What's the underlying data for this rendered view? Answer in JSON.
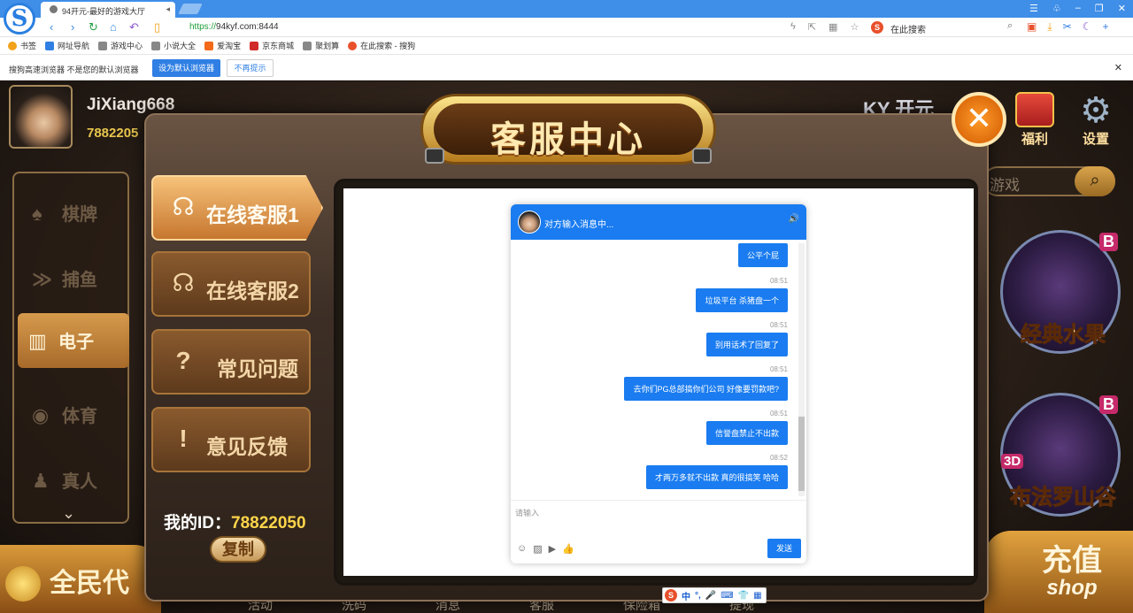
{
  "browser": {
    "logo": "S",
    "tab_title": "94开元-最好的游戏大厅",
    "tab_close": "◂",
    "url_scheme": "https://",
    "url_host": "94kyf.com:8444",
    "search_engine_label": "S",
    "search_placeholder": "在此搜索",
    "bookmarks": [
      {
        "label": "书签",
        "color": "#f2a21a"
      },
      {
        "label": "网址导航",
        "color": "#2f7fe4"
      },
      {
        "label": "游戏中心",
        "color": "#888888"
      },
      {
        "label": "小说大全",
        "color": "#888888"
      },
      {
        "label": "爱淘宝",
        "color": "#f26a1a"
      },
      {
        "label": "京东商城",
        "color": "#d12a2a"
      },
      {
        "label": "聚划算",
        "color": "#888888"
      },
      {
        "label": "在此搜索 - 搜狗",
        "color": "#e8502c"
      }
    ],
    "infobar": {
      "text": "搜狗高速浏览器 不是您的默认浏览器",
      "set_default": "设为默认浏览器",
      "dont_remind": "不再提示",
      "close": "✕"
    }
  },
  "game": {
    "username": "JiXiang668",
    "user_id_partial": "7882205",
    "side_menu": [
      {
        "label": "棋牌",
        "icon": "card-icon"
      },
      {
        "label": "捕鱼",
        "icon": "fish-icon"
      },
      {
        "label": "电子",
        "icon": "slot-icon",
        "active": true
      },
      {
        "label": "体育",
        "icon": "ball-icon"
      },
      {
        "label": "真人",
        "icon": "person-icon"
      }
    ],
    "quanmin": "全民代",
    "top_right_logo": "KY 开元",
    "fuli": "福利",
    "shezhi": "设置",
    "search_game": "游戏",
    "tiles": [
      {
        "name": "经典水果",
        "badge": "B"
      },
      {
        "name": "布法罗山谷",
        "badge": "B",
        "badge3d": "3D"
      }
    ],
    "recharge": "充值",
    "shop": "shop",
    "bottom_nav": [
      "活动",
      "洗码",
      "消息",
      "客服",
      "保险箱",
      "提现"
    ]
  },
  "modal": {
    "title": "客服中心",
    "close": "✕",
    "buttons": [
      {
        "label": "在线客服1",
        "icon": "headset-icon",
        "active": true
      },
      {
        "label": "在线客服2",
        "icon": "headset-icon"
      },
      {
        "label": "常见问题",
        "icon": "question-icon"
      },
      {
        "label": "意见反馈",
        "icon": "exclamation-icon"
      }
    ],
    "my_id_label": "我的ID：",
    "my_id": "78822050",
    "copy": "复制"
  },
  "chat": {
    "header_title": "对方输入消息中...",
    "messages": [
      {
        "time": "",
        "text": "公平个屁"
      },
      {
        "time": "08:51",
        "text": "垃圾平台 杀猪盘一个"
      },
      {
        "time": "08:51",
        "text": "别用话术了回复了"
      },
      {
        "time": "08:51",
        "text": "去你们PG总部搞你们公司 好像要罚款吧?"
      },
      {
        "time": "08:51",
        "text": "信誉盘禁止不出款"
      },
      {
        "time": "08:52",
        "text": "才两万多就不出款 真的很搞笑 哈哈"
      }
    ],
    "input_placeholder": "请输入",
    "send": "发送"
  },
  "ime": {
    "label": "S",
    "mode": "中"
  }
}
